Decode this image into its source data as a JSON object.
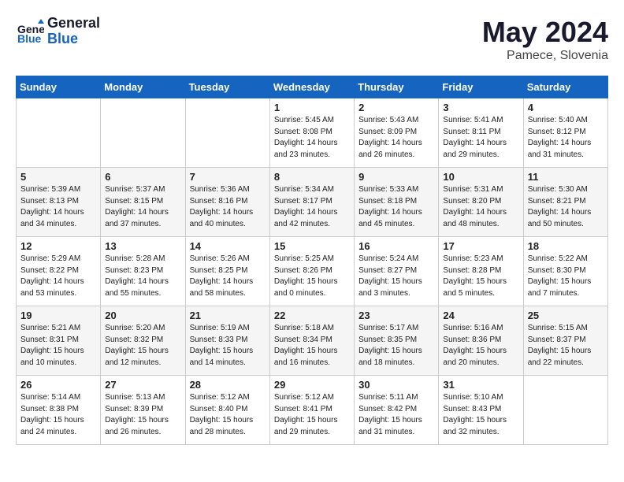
{
  "header": {
    "logo_line1": "General",
    "logo_line2": "Blue",
    "month": "May 2024",
    "location": "Pamece, Slovenia"
  },
  "weekdays": [
    "Sunday",
    "Monday",
    "Tuesday",
    "Wednesday",
    "Thursday",
    "Friday",
    "Saturday"
  ],
  "weeks": [
    [
      {
        "day": "",
        "sunrise": "",
        "sunset": "",
        "daylight": ""
      },
      {
        "day": "",
        "sunrise": "",
        "sunset": "",
        "daylight": ""
      },
      {
        "day": "",
        "sunrise": "",
        "sunset": "",
        "daylight": ""
      },
      {
        "day": "1",
        "sunrise": "Sunrise: 5:45 AM",
        "sunset": "Sunset: 8:08 PM",
        "daylight": "Daylight: 14 hours and 23 minutes."
      },
      {
        "day": "2",
        "sunrise": "Sunrise: 5:43 AM",
        "sunset": "Sunset: 8:09 PM",
        "daylight": "Daylight: 14 hours and 26 minutes."
      },
      {
        "day": "3",
        "sunrise": "Sunrise: 5:41 AM",
        "sunset": "Sunset: 8:11 PM",
        "daylight": "Daylight: 14 hours and 29 minutes."
      },
      {
        "day": "4",
        "sunrise": "Sunrise: 5:40 AM",
        "sunset": "Sunset: 8:12 PM",
        "daylight": "Daylight: 14 hours and 31 minutes."
      }
    ],
    [
      {
        "day": "5",
        "sunrise": "Sunrise: 5:39 AM",
        "sunset": "Sunset: 8:13 PM",
        "daylight": "Daylight: 14 hours and 34 minutes."
      },
      {
        "day": "6",
        "sunrise": "Sunrise: 5:37 AM",
        "sunset": "Sunset: 8:15 PM",
        "daylight": "Daylight: 14 hours and 37 minutes."
      },
      {
        "day": "7",
        "sunrise": "Sunrise: 5:36 AM",
        "sunset": "Sunset: 8:16 PM",
        "daylight": "Daylight: 14 hours and 40 minutes."
      },
      {
        "day": "8",
        "sunrise": "Sunrise: 5:34 AM",
        "sunset": "Sunset: 8:17 PM",
        "daylight": "Daylight: 14 hours and 42 minutes."
      },
      {
        "day": "9",
        "sunrise": "Sunrise: 5:33 AM",
        "sunset": "Sunset: 8:18 PM",
        "daylight": "Daylight: 14 hours and 45 minutes."
      },
      {
        "day": "10",
        "sunrise": "Sunrise: 5:31 AM",
        "sunset": "Sunset: 8:20 PM",
        "daylight": "Daylight: 14 hours and 48 minutes."
      },
      {
        "day": "11",
        "sunrise": "Sunrise: 5:30 AM",
        "sunset": "Sunset: 8:21 PM",
        "daylight": "Daylight: 14 hours and 50 minutes."
      }
    ],
    [
      {
        "day": "12",
        "sunrise": "Sunrise: 5:29 AM",
        "sunset": "Sunset: 8:22 PM",
        "daylight": "Daylight: 14 hours and 53 minutes."
      },
      {
        "day": "13",
        "sunrise": "Sunrise: 5:28 AM",
        "sunset": "Sunset: 8:23 PM",
        "daylight": "Daylight: 14 hours and 55 minutes."
      },
      {
        "day": "14",
        "sunrise": "Sunrise: 5:26 AM",
        "sunset": "Sunset: 8:25 PM",
        "daylight": "Daylight: 14 hours and 58 minutes."
      },
      {
        "day": "15",
        "sunrise": "Sunrise: 5:25 AM",
        "sunset": "Sunset: 8:26 PM",
        "daylight": "Daylight: 15 hours and 0 minutes."
      },
      {
        "day": "16",
        "sunrise": "Sunrise: 5:24 AM",
        "sunset": "Sunset: 8:27 PM",
        "daylight": "Daylight: 15 hours and 3 minutes."
      },
      {
        "day": "17",
        "sunrise": "Sunrise: 5:23 AM",
        "sunset": "Sunset: 8:28 PM",
        "daylight": "Daylight: 15 hours and 5 minutes."
      },
      {
        "day": "18",
        "sunrise": "Sunrise: 5:22 AM",
        "sunset": "Sunset: 8:30 PM",
        "daylight": "Daylight: 15 hours and 7 minutes."
      }
    ],
    [
      {
        "day": "19",
        "sunrise": "Sunrise: 5:21 AM",
        "sunset": "Sunset: 8:31 PM",
        "daylight": "Daylight: 15 hours and 10 minutes."
      },
      {
        "day": "20",
        "sunrise": "Sunrise: 5:20 AM",
        "sunset": "Sunset: 8:32 PM",
        "daylight": "Daylight: 15 hours and 12 minutes."
      },
      {
        "day": "21",
        "sunrise": "Sunrise: 5:19 AM",
        "sunset": "Sunset: 8:33 PM",
        "daylight": "Daylight: 15 hours and 14 minutes."
      },
      {
        "day": "22",
        "sunrise": "Sunrise: 5:18 AM",
        "sunset": "Sunset: 8:34 PM",
        "daylight": "Daylight: 15 hours and 16 minutes."
      },
      {
        "day": "23",
        "sunrise": "Sunrise: 5:17 AM",
        "sunset": "Sunset: 8:35 PM",
        "daylight": "Daylight: 15 hours and 18 minutes."
      },
      {
        "day": "24",
        "sunrise": "Sunrise: 5:16 AM",
        "sunset": "Sunset: 8:36 PM",
        "daylight": "Daylight: 15 hours and 20 minutes."
      },
      {
        "day": "25",
        "sunrise": "Sunrise: 5:15 AM",
        "sunset": "Sunset: 8:37 PM",
        "daylight": "Daylight: 15 hours and 22 minutes."
      }
    ],
    [
      {
        "day": "26",
        "sunrise": "Sunrise: 5:14 AM",
        "sunset": "Sunset: 8:38 PM",
        "daylight": "Daylight: 15 hours and 24 minutes."
      },
      {
        "day": "27",
        "sunrise": "Sunrise: 5:13 AM",
        "sunset": "Sunset: 8:39 PM",
        "daylight": "Daylight: 15 hours and 26 minutes."
      },
      {
        "day": "28",
        "sunrise": "Sunrise: 5:12 AM",
        "sunset": "Sunset: 8:40 PM",
        "daylight": "Daylight: 15 hours and 28 minutes."
      },
      {
        "day": "29",
        "sunrise": "Sunrise: 5:12 AM",
        "sunset": "Sunset: 8:41 PM",
        "daylight": "Daylight: 15 hours and 29 minutes."
      },
      {
        "day": "30",
        "sunrise": "Sunrise: 5:11 AM",
        "sunset": "Sunset: 8:42 PM",
        "daylight": "Daylight: 15 hours and 31 minutes."
      },
      {
        "day": "31",
        "sunrise": "Sunrise: 5:10 AM",
        "sunset": "Sunset: 8:43 PM",
        "daylight": "Daylight: 15 hours and 32 minutes."
      },
      {
        "day": "",
        "sunrise": "",
        "sunset": "",
        "daylight": ""
      }
    ]
  ]
}
